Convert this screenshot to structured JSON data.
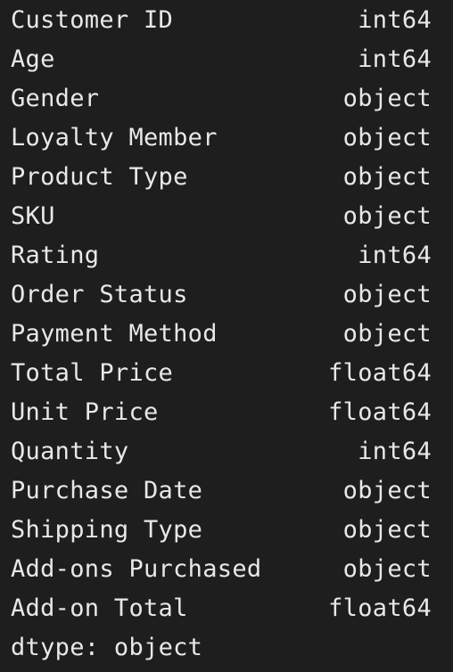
{
  "rows": [
    {
      "name": "Customer ID",
      "dtype": "int64"
    },
    {
      "name": "Age",
      "dtype": "int64"
    },
    {
      "name": "Gender",
      "dtype": "object"
    },
    {
      "name": "Loyalty Member",
      "dtype": "object"
    },
    {
      "name": "Product Type",
      "dtype": "object"
    },
    {
      "name": "SKU",
      "dtype": "object"
    },
    {
      "name": "Rating",
      "dtype": "int64"
    },
    {
      "name": "Order Status",
      "dtype": "object"
    },
    {
      "name": "Payment Method",
      "dtype": "object"
    },
    {
      "name": "Total Price",
      "dtype": "float64"
    },
    {
      "name": "Unit Price",
      "dtype": "float64"
    },
    {
      "name": "Quantity",
      "dtype": "int64"
    },
    {
      "name": "Purchase Date",
      "dtype": "object"
    },
    {
      "name": "Shipping Type",
      "dtype": "object"
    },
    {
      "name": "Add-ons Purchased",
      "dtype": "object"
    },
    {
      "name": "Add-on Total",
      "dtype": "float64"
    }
  ],
  "footer": {
    "label": "dtype:",
    "value": "object"
  },
  "colors": {
    "background": "#1e1e1e",
    "text": "#e8e8e8"
  }
}
